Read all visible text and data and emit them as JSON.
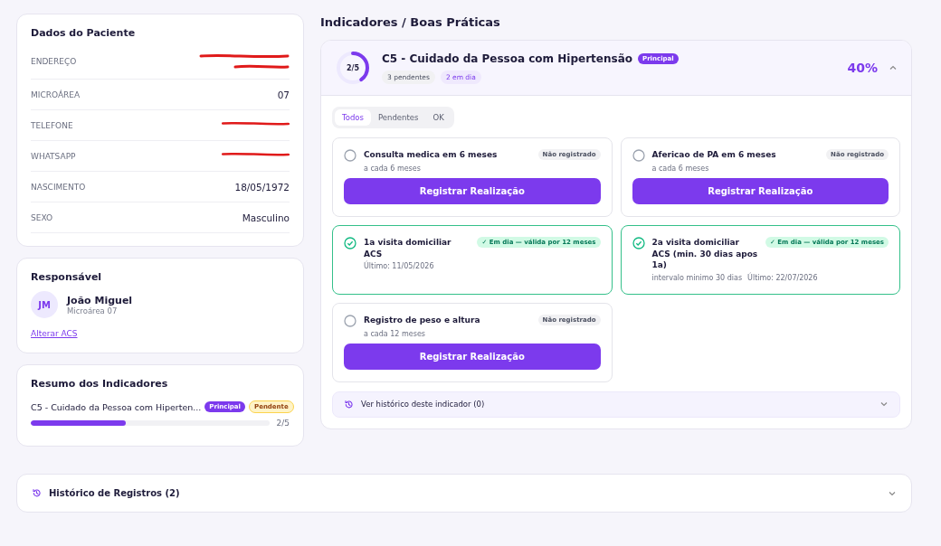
{
  "patient": {
    "title": "Dados do Paciente",
    "fields": [
      {
        "label": "ENDEREÇO",
        "redacted": true
      },
      {
        "label": "MICROÁREA",
        "value": "07",
        "redacted": false
      },
      {
        "label": "TELEFONE",
        "redacted": true
      },
      {
        "label": "WHATSAPP",
        "redacted": true
      },
      {
        "label": "NASCIMENTO",
        "value": "18/05/1972",
        "redacted": false
      },
      {
        "label": "SEXO",
        "value": "Masculino",
        "redacted": false
      }
    ]
  },
  "responsible": {
    "title": "Responsável",
    "initials": "JM",
    "name": "João Miguel",
    "subtitle": "Microárea 07",
    "link": "Alterar ACS"
  },
  "summary": {
    "title": "Resumo dos Indicadores",
    "items": [
      {
        "name": "C5 - Cuidado da Pessoa com Hiperten...",
        "badge": "Principal",
        "status": "Pendente",
        "level": 0.4,
        "count": "2/5"
      }
    ]
  },
  "indicators": {
    "title": "Indicadores / Boas Práticas",
    "card": {
      "ring_label": "2/5",
      "level": 0.4,
      "name": "C5 - Cuidado da Pessoa com Hipertensão",
      "badge": "Principal",
      "chips": [
        {
          "text": "3 pendentes",
          "kind": "pending"
        },
        {
          "text": "2 em dia",
          "kind": "ok"
        }
      ],
      "percent": "40%",
      "expanded": true,
      "filters": [
        {
          "label": "Todos",
          "selected": true
        },
        {
          "label": "Pendentes",
          "selected": false
        },
        {
          "label": "OK",
          "selected": false
        }
      ],
      "tasks": [
        {
          "title": "Consulta medica em 6 meses",
          "done": false,
          "status": "Não registrado",
          "meta": [
            "a cada 6 meses"
          ],
          "button": "Registrar Realização"
        },
        {
          "title": "Afericao de PA em 6 meses",
          "done": false,
          "status": "Não registrado",
          "meta": [
            "a cada 6 meses"
          ],
          "button": "Registrar Realização"
        },
        {
          "title": "1a visita domiciliar ACS",
          "done": true,
          "status": "✓ Em dia — válida por 12 meses",
          "meta": [
            "Último: 11/05/2026"
          ]
        },
        {
          "title": "2a visita domiciliar ACS (min. 30 dias apos 1a)",
          "done": true,
          "status": "✓ Em dia — válida por 12 meses",
          "meta": [
            "intervalo minimo 30 dias",
            "Último: 22/07/2026"
          ]
        },
        {
          "title": "Registro de peso e altura",
          "done": false,
          "status": "Não registrado",
          "meta": [
            "a cada 12 meses"
          ],
          "button": "Registrar Realização"
        }
      ],
      "history": {
        "label": "Ver histórico deste indicador (0)",
        "expanded": false
      }
    }
  },
  "records": {
    "label": "Histórico de Registros (2)",
    "expanded": false
  }
}
